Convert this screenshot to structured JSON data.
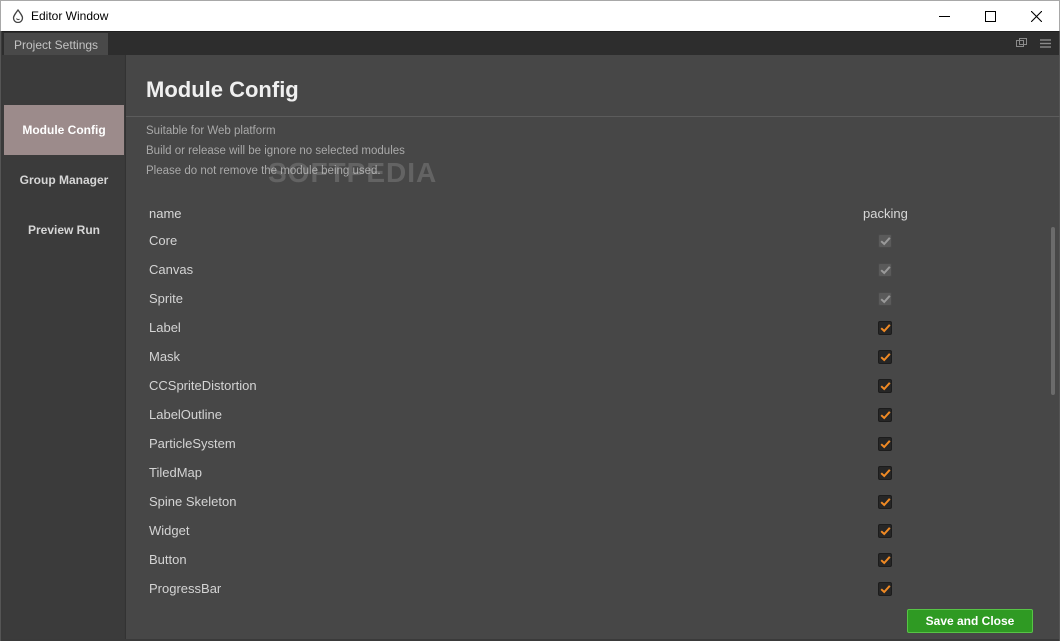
{
  "window": {
    "title": "Editor Window",
    "controls": [
      "minimize-icon",
      "maximize-icon",
      "close-icon"
    ]
  },
  "tabbar": {
    "tab_label": "Project Settings",
    "tools": [
      "restore-panel-icon",
      "menu-icon"
    ]
  },
  "sidebar": {
    "items": [
      {
        "label": "Module Config",
        "active": true
      },
      {
        "label": "Group Manager",
        "active": false
      },
      {
        "label": "Preview Run",
        "active": false
      }
    ]
  },
  "main": {
    "title": "Module Config",
    "description": [
      "Suitable for Web platform",
      "Build or release will be ignore no selected modules",
      "Please do not remove the module being used."
    ],
    "watermark": "SOFTPEDIA",
    "columns": {
      "name": "name",
      "packing": "packing"
    },
    "modules": [
      {
        "name": "Core",
        "packing": true,
        "disabled": true
      },
      {
        "name": "Canvas",
        "packing": true,
        "disabled": true
      },
      {
        "name": "Sprite",
        "packing": true,
        "disabled": true
      },
      {
        "name": "Label",
        "packing": true,
        "disabled": false
      },
      {
        "name": "Mask",
        "packing": true,
        "disabled": false
      },
      {
        "name": "CCSpriteDistortion",
        "packing": true,
        "disabled": false
      },
      {
        "name": "LabelOutline",
        "packing": true,
        "disabled": false
      },
      {
        "name": "ParticleSystem",
        "packing": true,
        "disabled": false
      },
      {
        "name": "TiledMap",
        "packing": true,
        "disabled": false
      },
      {
        "name": "Spine Skeleton",
        "packing": true,
        "disabled": false
      },
      {
        "name": "Widget",
        "packing": true,
        "disabled": false
      },
      {
        "name": "Button",
        "packing": true,
        "disabled": false
      },
      {
        "name": "ProgressBar",
        "packing": true,
        "disabled": false
      }
    ],
    "save_button": "Save and Close"
  },
  "colors": {
    "active_sidebar": "#9c8b8b",
    "checkbox_check": "#f08a24",
    "disabled_check": "#9a9a9a",
    "save_button": "#2f9a23"
  }
}
